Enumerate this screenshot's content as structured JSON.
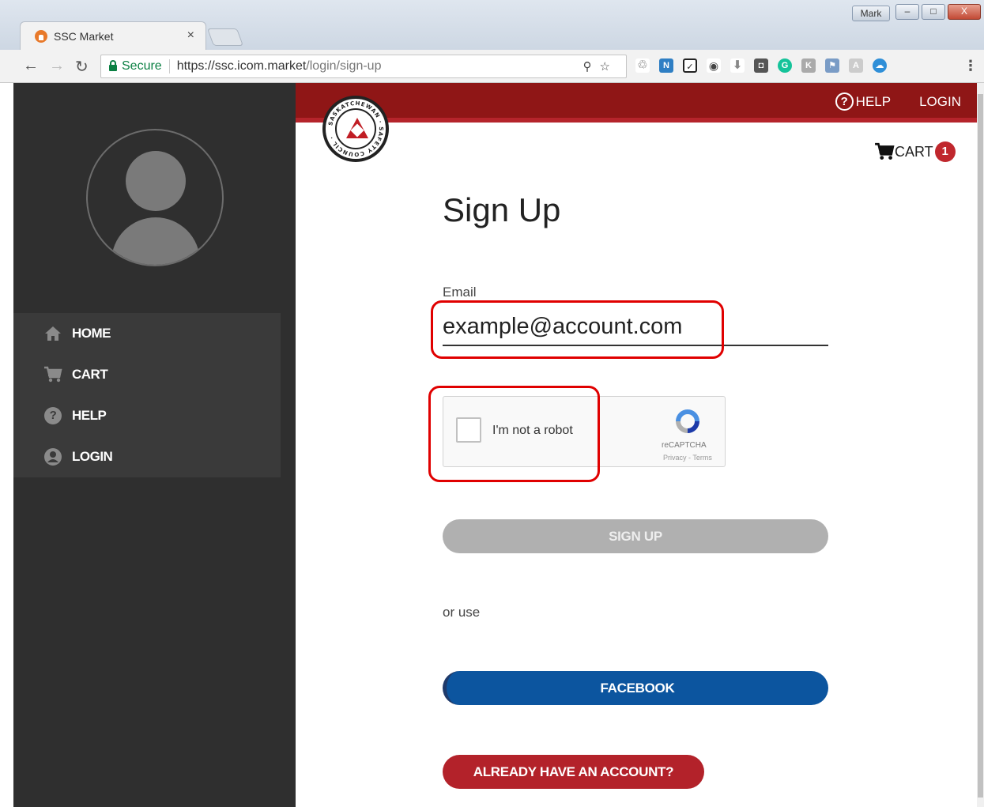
{
  "window": {
    "user": "Mark",
    "minimize": "–",
    "maximize": "□",
    "close": "X"
  },
  "tab": {
    "title": "SSC Market",
    "close": "×"
  },
  "address": {
    "secure_label": "Secure",
    "url_host": "https://ssc.icom.market",
    "url_path": "/login/sign-up"
  },
  "sidebar": {
    "items": [
      {
        "label": "HOME",
        "icon": "home-icon"
      },
      {
        "label": "CART",
        "icon": "cart-icon"
      },
      {
        "label": "HELP",
        "icon": "help-icon"
      },
      {
        "label": "LOGIN",
        "icon": "account-icon"
      }
    ]
  },
  "header": {
    "help": "HELP",
    "login": "LOGIN",
    "cart": "CART",
    "cart_count": "1"
  },
  "form": {
    "title": "Sign Up",
    "email_label": "Email",
    "email_value": "example@account.com",
    "captcha_text": "I'm not a robot",
    "captcha_brand": "reCAPTCHA",
    "captcha_terms": "Privacy - Terms",
    "signup_button": "SIGN UP",
    "or_use": "or use",
    "facebook_button": "FACEBOOK",
    "account_button": "ALREADY HAVE AN ACCOUNT?"
  },
  "colors": {
    "brand_red": "#8f1616",
    "facebook_blue": "#0c559f",
    "highlight_red": "#e00000"
  }
}
